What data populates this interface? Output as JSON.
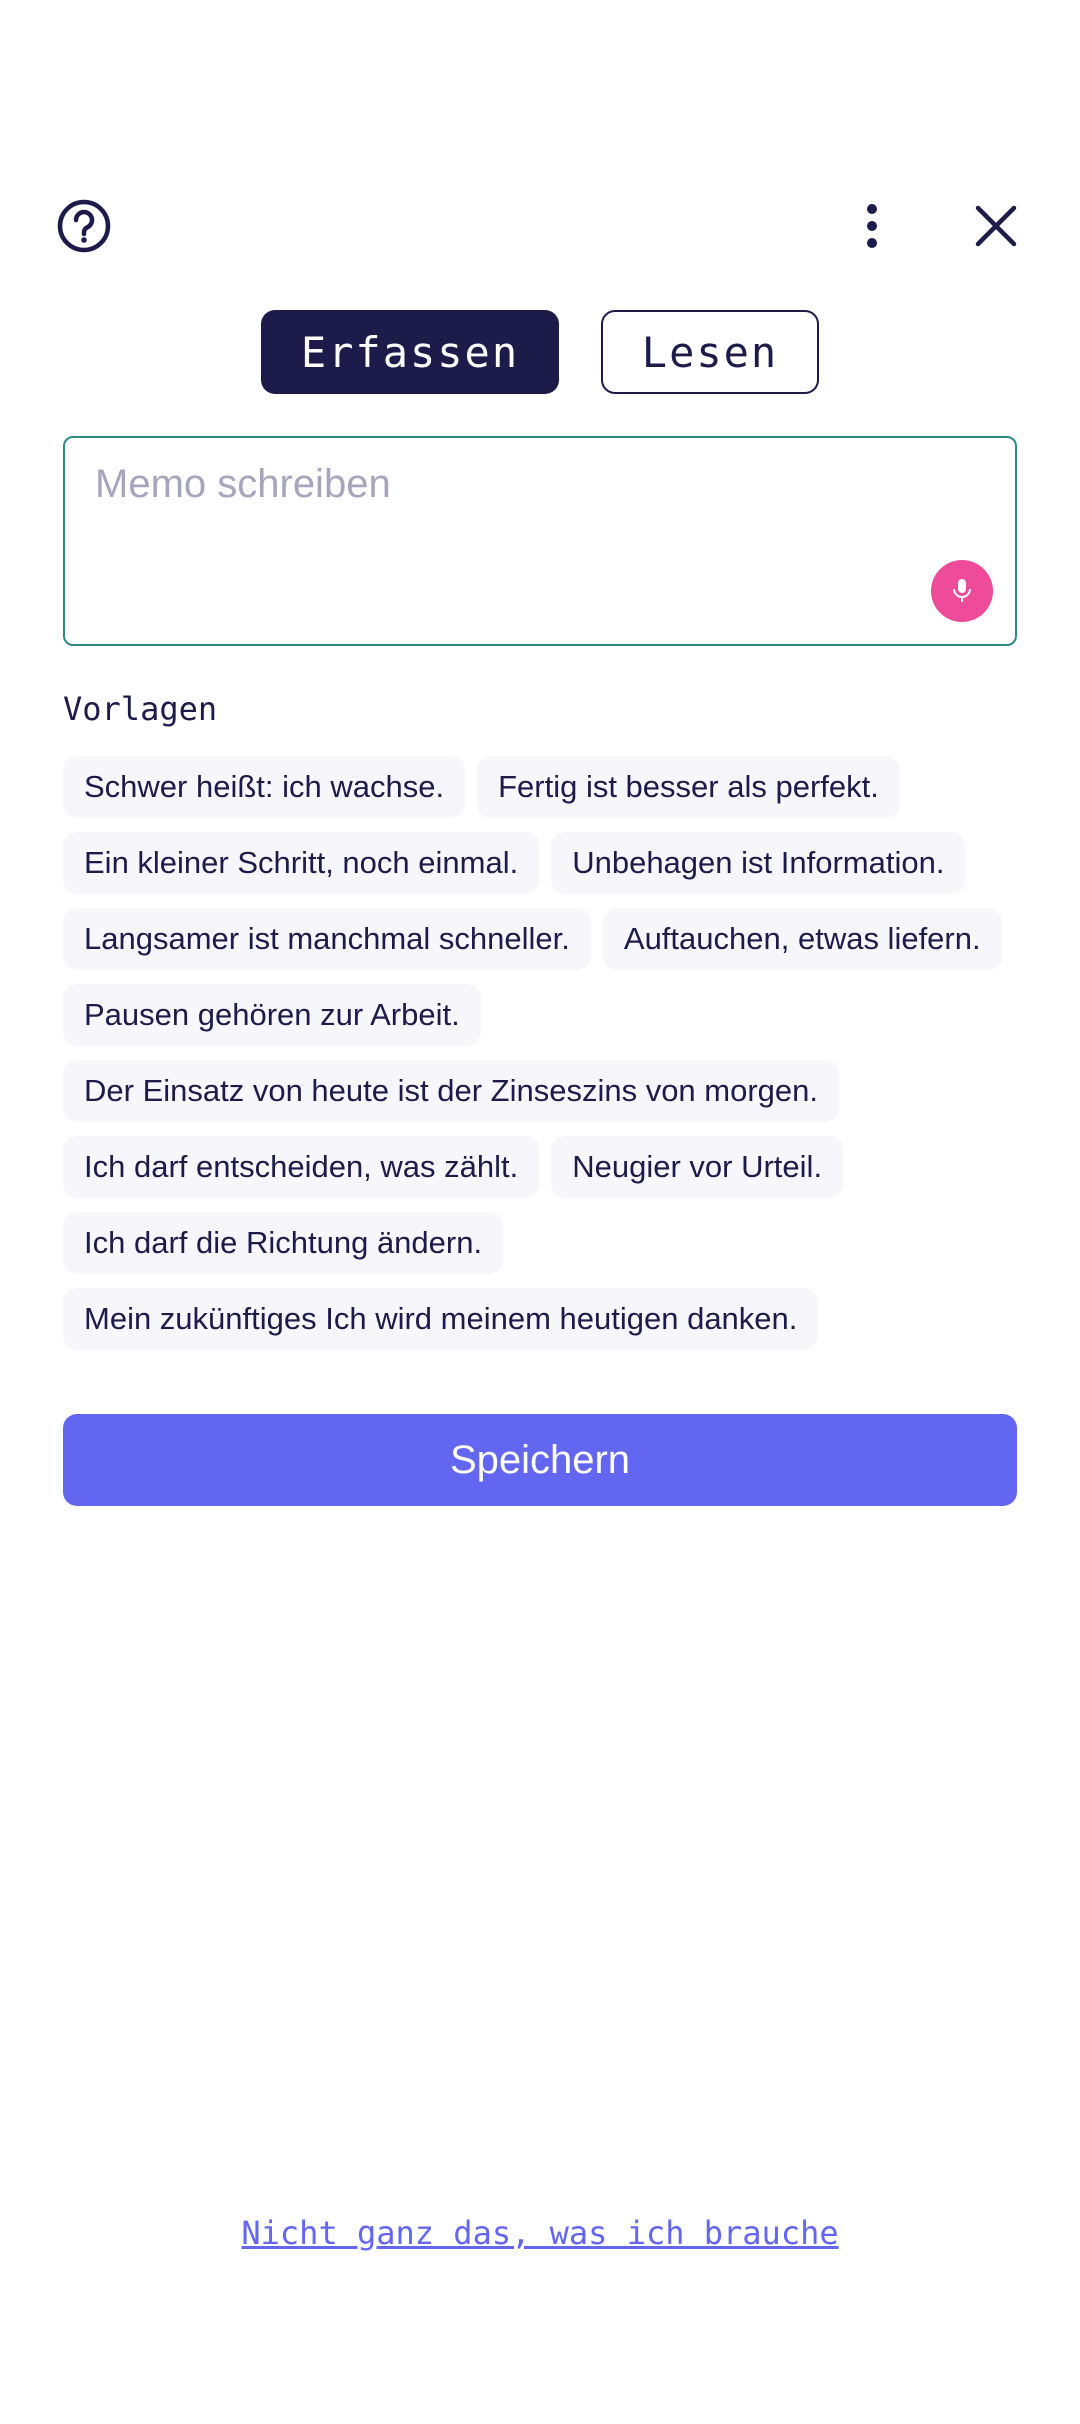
{
  "header": {
    "help_icon": "help-circle-icon",
    "more_icon": "more-vertical-icon",
    "close_icon": "close-icon"
  },
  "tabs": [
    {
      "label": "Erfassen",
      "active": true
    },
    {
      "label": "Lesen",
      "active": false
    }
  ],
  "memo": {
    "placeholder": "Memo schreiben",
    "value": "",
    "mic_icon": "microphone-icon"
  },
  "templates": {
    "title": "Vorlagen",
    "items": [
      "Schwer heißt: ich wachse.",
      "Fertig ist besser als perfekt.",
      "Ein kleiner Schritt, noch einmal.",
      "Unbehagen ist Information.",
      "Langsamer ist manchmal schneller.",
      "Auftauchen, etwas liefern.",
      "Pausen gehören zur Arbeit.",
      "Der Einsatz von heute ist der Zinseszins von morgen.",
      "Ich darf entscheiden, was zählt.",
      "Neugier vor Urteil.",
      "Ich darf die Richtung ändern.",
      "Mein zukünftiges Ich wird meinem heutigen danken."
    ]
  },
  "save_label": "Speichern",
  "footer_link": "Nicht ganz das, was ich brauche",
  "colors": {
    "primary": "#1c1b4a",
    "accent": "#6366f1",
    "mic": "#ee4c9b",
    "border": "#2f8a86"
  }
}
